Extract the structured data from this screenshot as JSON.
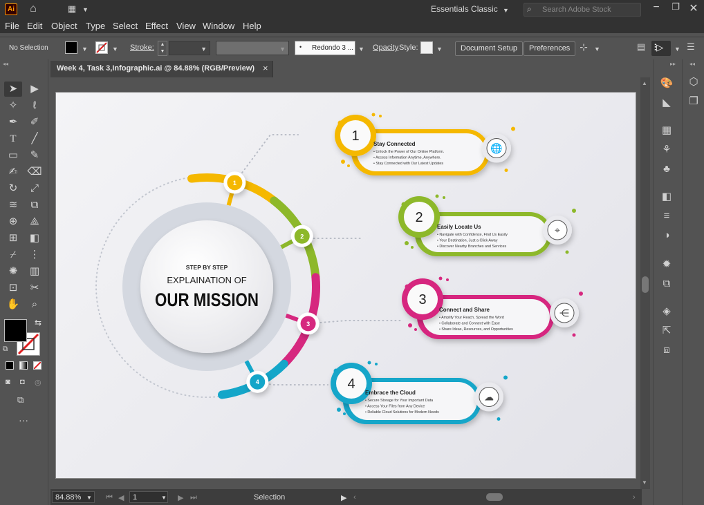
{
  "app": {
    "logo": "Ai",
    "workspace": "Essentials Classic",
    "search_placeholder": "Search Adobe Stock"
  },
  "menu": [
    "File",
    "Edit",
    "Object",
    "Type",
    "Select",
    "Effect",
    "View",
    "Window",
    "Help"
  ],
  "control_bar": {
    "selection_label": "No Selection",
    "stroke_label": "Stroke:",
    "brush_value": "Redondo 3 ...",
    "opacity_label": "Opacity",
    "style_label": "Style:",
    "document_setup": "Document Setup",
    "preferences": "Preferences"
  },
  "document_tab": {
    "title": "Week 4, Task 3,Infographic.ai @ 84.88% (RGB/Preview)",
    "close": "×"
  },
  "status": {
    "zoom": "84.88%",
    "artboard_number": "1",
    "tool": "Selection"
  },
  "colors": {
    "yellow": "#f5b800",
    "green": "#8db82a",
    "magenta": "#d6287f",
    "cyan": "#14a6c9",
    "gray_ring": "#d4d8e0"
  },
  "infographic": {
    "center": {
      "line1": "STEP BY STEP",
      "line2": "EXPLAINATION OF",
      "line3": "OUR MISSION"
    },
    "steps": [
      {
        "number": "1",
        "title": "Stay Connected",
        "icon": "globe-icon",
        "bullets": [
          "• Unlock the Power of Our Online Platform.",
          "• Access Information Anytime, Anywhere.",
          "• Stay Connected with Our Latest Updates"
        ]
      },
      {
        "number": "2",
        "title": "Easily Locate Us",
        "icon": "location-pin-icon",
        "bullets": [
          "• Navigate with Confidence, Find Us Easily",
          "• Your Destination, Just a Click Away",
          "• Discover Nearby Branches and Services"
        ]
      },
      {
        "number": "3",
        "title": "Connect and Share",
        "icon": "share-icon",
        "bullets": [
          "• Amplify Your Reach, Spread the Word",
          "• Collaborate and Connect with Ease",
          "• Share Ideas, Resources, and Opportunities"
        ]
      },
      {
        "number": "4",
        "title": "Embrace the Cloud",
        "icon": "cloud-upload-icon",
        "bullets": [
          "• Secure Storage for Your Important Data",
          "• Access Your Files from Any Device",
          "• Reliable Cloud Solutions for Modern Needs"
        ]
      }
    ]
  }
}
